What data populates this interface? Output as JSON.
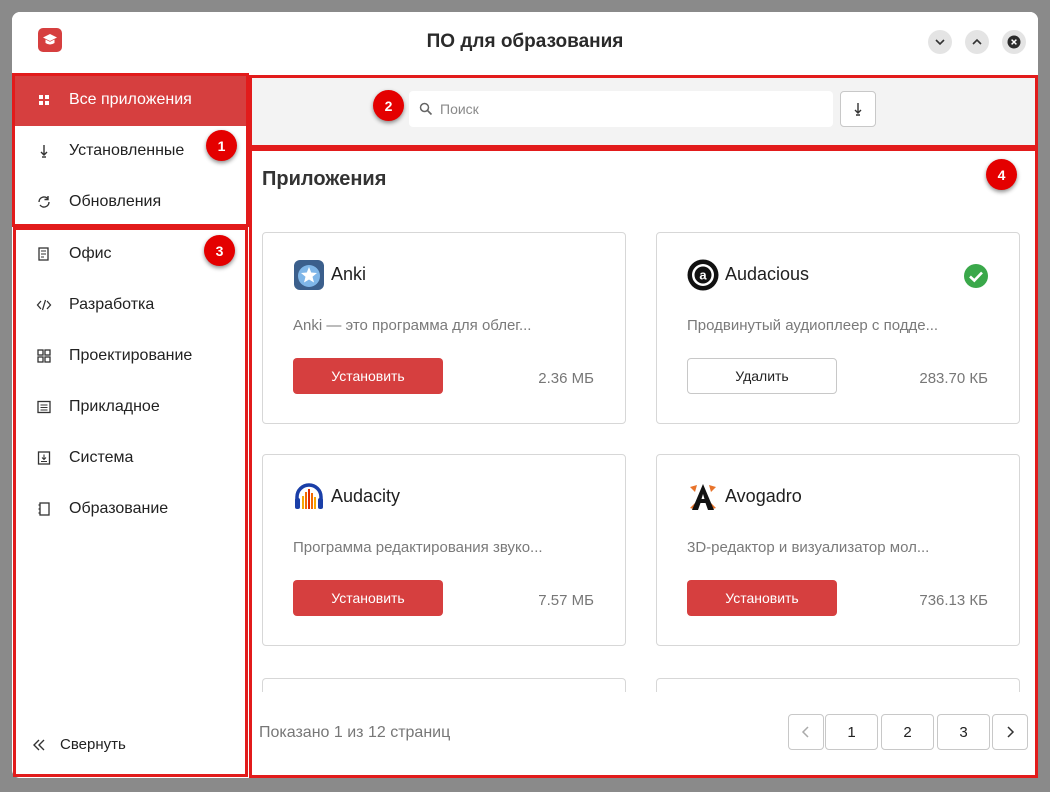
{
  "window": {
    "title": "ПО для образования"
  },
  "sidebar": {
    "main_items": [
      {
        "label": "Все приложения",
        "icon": "grid-icon",
        "active": true
      },
      {
        "label": "Установленные",
        "icon": "download-icon",
        "active": false
      },
      {
        "label": "Обновления",
        "icon": "refresh-icon",
        "active": false
      }
    ],
    "categories": [
      {
        "label": "Офис",
        "icon": "document-edit-icon"
      },
      {
        "label": "Разработка",
        "icon": "code-icon"
      },
      {
        "label": "Проектирование",
        "icon": "blocks-icon"
      },
      {
        "label": "Прикладное",
        "icon": "list-icon"
      },
      {
        "label": "Система",
        "icon": "system-icon"
      },
      {
        "label": "Образование",
        "icon": "book-icon"
      }
    ],
    "collapse_label": "Свернуть"
  },
  "search": {
    "placeholder": "Поиск",
    "value": ""
  },
  "section_title": "Приложения",
  "apps": [
    {
      "name": "Anki",
      "description": "Anki — это программа для облег...",
      "action": "Установить",
      "installed": false,
      "size": "2.36 МБ"
    },
    {
      "name": "Audacious",
      "description": "Продвинутый аудиоплеер с подде...",
      "action": "Удалить",
      "installed": true,
      "size": "283.70 КБ"
    },
    {
      "name": "Audacity",
      "description": "Программа редактирования звуко...",
      "action": "Установить",
      "installed": false,
      "size": "7.57 МБ"
    },
    {
      "name": "Avogadro",
      "description": "3D-редактор и визуализатор мол...",
      "action": "Установить",
      "installed": false,
      "size": "736.13 КБ"
    }
  ],
  "pagination": {
    "summary": "Показано 1 из 12 страниц",
    "pages": [
      "1",
      "2",
      "3"
    ]
  },
  "annotations": [
    "1",
    "2",
    "3",
    "4"
  ],
  "colors": {
    "accent": "#d63f3f",
    "annotation": "#e21b1b",
    "installed_check": "#3aa84a"
  }
}
